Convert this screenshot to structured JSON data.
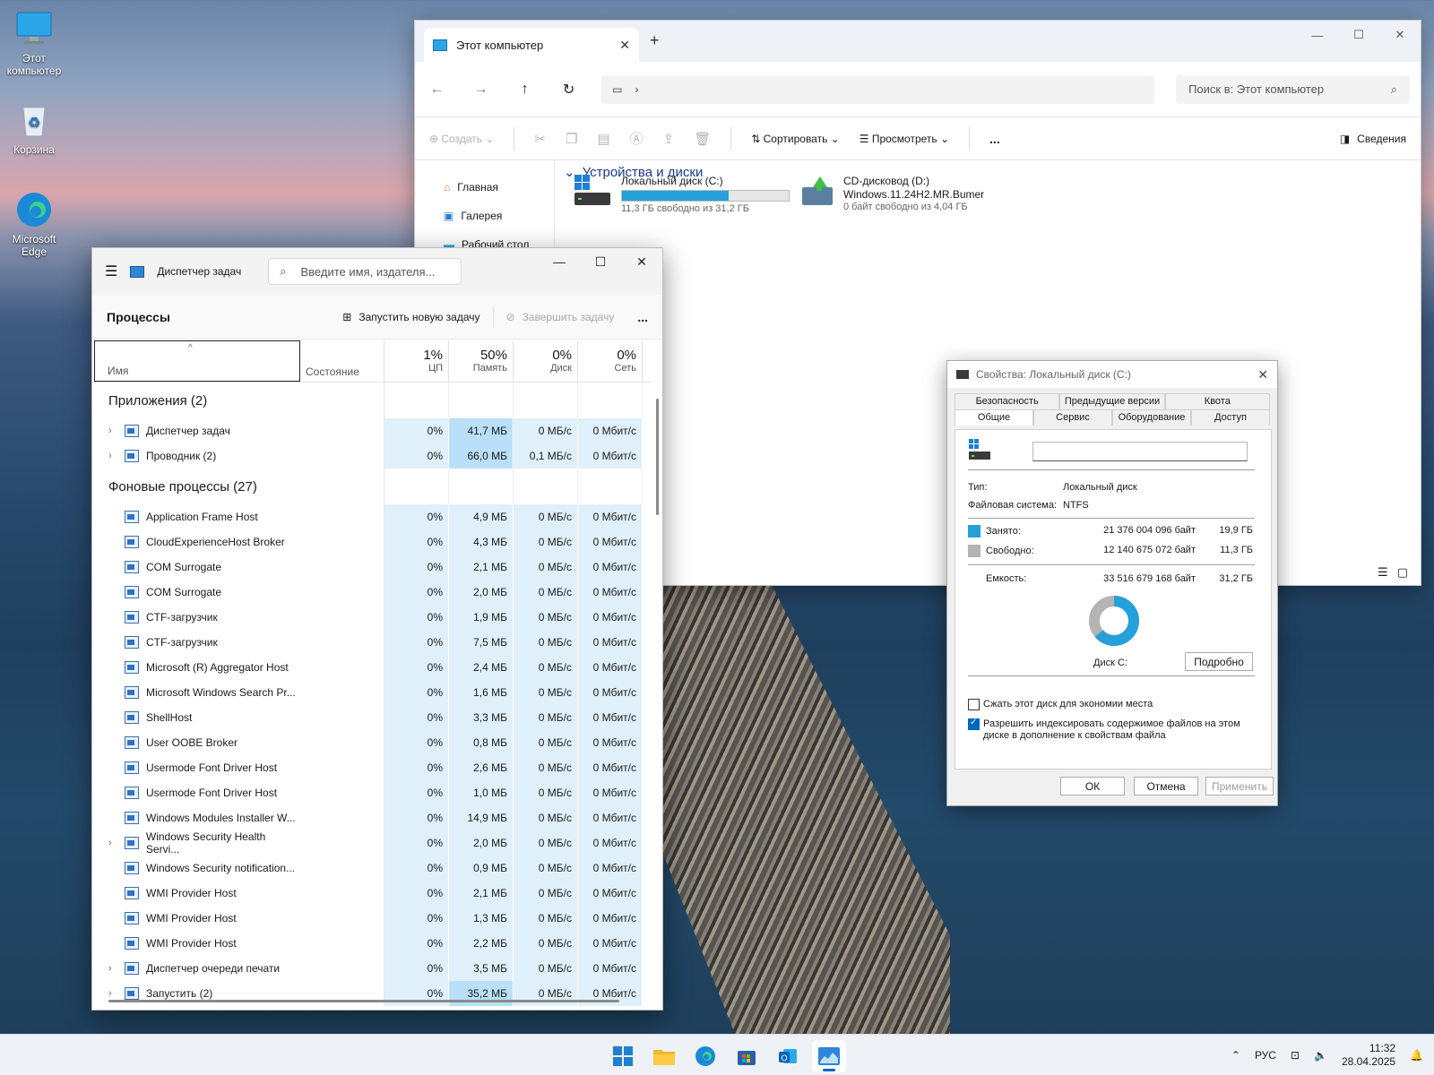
{
  "desktop": {
    "icons": [
      {
        "label": "Этот компьютер"
      },
      {
        "label": "Корзина"
      },
      {
        "label": "Microsoft Edge"
      }
    ]
  },
  "explorer": {
    "tab_title": "Этот компьютер",
    "search_placeholder": "Поиск в: Этот компьютер",
    "cmd": {
      "create": "Создать",
      "sort": "Сортировать",
      "view": "Просмотреть",
      "more": "...",
      "details": "Сведения"
    },
    "sidebar": [
      {
        "label": "Главная"
      },
      {
        "label": "Галерея"
      },
      {
        "label": "Рабочий стол"
      }
    ],
    "group_title": "Устройства и диски",
    "drives": [
      {
        "name": "Локальный диск (C:)",
        "free": "11,3 ГБ свободно из 31,2 ГБ",
        "used_fraction": 0.64
      },
      {
        "name": "CD-дисковод (D:)",
        "label": "Windows.11.24H2.MR.Bumer",
        "free": "0 байт свободно из 4,04 ГБ"
      }
    ]
  },
  "taskmgr": {
    "title": "Диспетчер задач",
    "search_placeholder": "Введите имя, издателя...",
    "section": "Процессы",
    "run_task": "Запустить новую задачу",
    "end_task": "Завершить задачу",
    "more": "...",
    "columns": {
      "name": "Имя",
      "state": "Состояние",
      "cpu": {
        "pct": "1%",
        "label": "ЦП"
      },
      "mem": {
        "pct": "50%",
        "label": "Память"
      },
      "disk": {
        "pct": "0%",
        "label": "Диск"
      },
      "net": {
        "pct": "0%",
        "label": "Сеть"
      }
    },
    "apps_group": "Приложения (2)",
    "apps": [
      {
        "name": "Диспетчер задач",
        "cpu": "0%",
        "mem": "41,7 МБ",
        "disk": "0 МБ/с",
        "net": "0 Мбит/с"
      },
      {
        "name": "Проводник (2)",
        "cpu": "0%",
        "mem": "66,0 МБ",
        "disk": "0,1 МБ/с",
        "net": "0 Мбит/с"
      }
    ],
    "bg_group": "Фоновые процессы (27)",
    "bg": [
      {
        "name": "Application Frame Host",
        "cpu": "0%",
        "mem": "4,9 МБ",
        "disk": "0 МБ/с",
        "net": "0 Мбит/с"
      },
      {
        "name": "CloudExperienceHost Broker",
        "cpu": "0%",
        "mem": "4,3 МБ",
        "disk": "0 МБ/с",
        "net": "0 Мбит/с"
      },
      {
        "name": "COM Surrogate",
        "cpu": "0%",
        "mem": "2,1 МБ",
        "disk": "0 МБ/с",
        "net": "0 Мбит/с"
      },
      {
        "name": "COM Surrogate",
        "cpu": "0%",
        "mem": "2,0 МБ",
        "disk": "0 МБ/с",
        "net": "0 Мбит/с"
      },
      {
        "name": "CTF-загрузчик",
        "cpu": "0%",
        "mem": "1,9 МБ",
        "disk": "0 МБ/с",
        "net": "0 Мбит/с"
      },
      {
        "name": "CTF-загрузчик",
        "cpu": "0%",
        "mem": "7,5 МБ",
        "disk": "0 МБ/с",
        "net": "0 Мбит/с"
      },
      {
        "name": "Microsoft (R) Aggregator Host",
        "cpu": "0%",
        "mem": "2,4 МБ",
        "disk": "0 МБ/с",
        "net": "0 Мбит/с"
      },
      {
        "name": "Microsoft Windows Search Pr...",
        "cpu": "0%",
        "mem": "1,6 МБ",
        "disk": "0 МБ/с",
        "net": "0 Мбит/с"
      },
      {
        "name": "ShellHost",
        "cpu": "0%",
        "mem": "3,3 МБ",
        "disk": "0 МБ/с",
        "net": "0 Мбит/с"
      },
      {
        "name": "User OOBE Broker",
        "cpu": "0%",
        "mem": "0,8 МБ",
        "disk": "0 МБ/с",
        "net": "0 Мбит/с"
      },
      {
        "name": "Usermode Font Driver Host",
        "cpu": "0%",
        "mem": "2,6 МБ",
        "disk": "0 МБ/с",
        "net": "0 Мбит/с"
      },
      {
        "name": "Usermode Font Driver Host",
        "cpu": "0%",
        "mem": "1,0 МБ",
        "disk": "0 МБ/с",
        "net": "0 Мбит/с"
      },
      {
        "name": "Windows Modules Installer W...",
        "cpu": "0%",
        "mem": "14,9 МБ",
        "disk": "0 МБ/с",
        "net": "0 Мбит/с"
      },
      {
        "name": "Windows Security Health Servi...",
        "cpu": "0%",
        "mem": "2,0 МБ",
        "disk": "0 МБ/с",
        "net": "0 Мбит/с",
        "expand": true
      },
      {
        "name": "Windows Security notification...",
        "cpu": "0%",
        "mem": "0,9 МБ",
        "disk": "0 МБ/с",
        "net": "0 Мбит/с"
      },
      {
        "name": "WMI Provider Host",
        "cpu": "0%",
        "mem": "2,1 МБ",
        "disk": "0 МБ/с",
        "net": "0 Мбит/с"
      },
      {
        "name": "WMI Provider Host",
        "cpu": "0%",
        "mem": "1,3 МБ",
        "disk": "0 МБ/с",
        "net": "0 Мбит/с"
      },
      {
        "name": "WMI Provider Host",
        "cpu": "0%",
        "mem": "2,2 МБ",
        "disk": "0 МБ/с",
        "net": "0 Мбит/с"
      },
      {
        "name": "Диспетчер очереди печати",
        "cpu": "0%",
        "mem": "3,5 МБ",
        "disk": "0 МБ/с",
        "net": "0 Мбит/с",
        "expand": true
      },
      {
        "name": "Запустить (2)",
        "cpu": "0%",
        "mem": "35,2 МБ",
        "disk": "0 МБ/с",
        "net": "0 Мбит/с",
        "expand": true,
        "hi": true
      }
    ]
  },
  "props": {
    "title": "Свойства: Локальный диск (C:)",
    "tabs_top": [
      "Безопасность",
      "Предыдущие версии",
      "Квота"
    ],
    "tabs_bottom": [
      "Общие",
      "Сервис",
      "Оборудование",
      "Доступ"
    ],
    "type_label": "Тип:",
    "type_value": "Локальный диск",
    "fs_label": "Файловая система:",
    "fs_value": "NTFS",
    "used_label": "Занято:",
    "used_bytes": "21 376 004 096 байт",
    "used_gb": "19,9 ГБ",
    "free_label": "Свободно:",
    "free_bytes": "12 140 675 072 байт",
    "free_gb": "11,3 ГБ",
    "cap_label": "Емкость:",
    "cap_bytes": "33 516 679 168 байт",
    "cap_gb": "31,2 ГБ",
    "disk_label": "Диск C:",
    "details_btn": "Подробно",
    "compress": "Сжать этот диск для экономии места",
    "index_line1": "Разрешить индексировать содержимое файлов на этом",
    "index_line2": "диске в дополнение к свойствам файла",
    "ok": "ОК",
    "cancel": "Отмена",
    "apply": "Применить",
    "used_fraction": 0.638,
    "colors": {
      "used": "#26a0da",
      "free": "#b4b4b4"
    }
  },
  "taskbar": {
    "lang": "РУС",
    "time": "11:32",
    "date": "28.04.2025"
  }
}
